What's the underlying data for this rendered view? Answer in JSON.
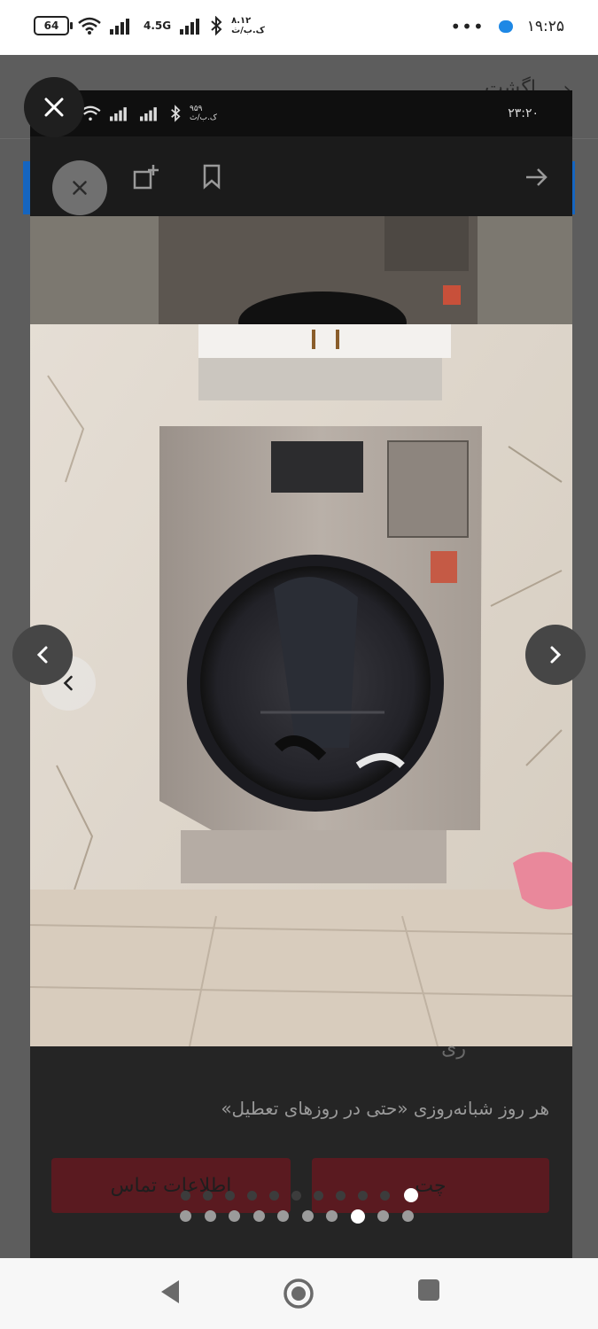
{
  "status_bar": {
    "battery": "64",
    "network": "4.5G",
    "speed": "۸.۱۲",
    "speed_unit": "ک.ب/ث",
    "more": "•••",
    "time": "۱۹:۲۵"
  },
  "background_page": {
    "title": "…اگشت"
  },
  "inner_screenshot": {
    "status_time": "۲۳:۲۰",
    "status_speed": "۹۵۹",
    "status_speed_unit": "ک.ب/ث",
    "hours_text": "هر روز شبانه‌روزی «حتی در روزهای تعطیل»",
    "contact_label": "اطلاعات تماس",
    "chat_label": "چت",
    "partial_text": "ری"
  },
  "pager": {
    "total": 10,
    "active_index": 7
  },
  "colors": {
    "accent_blue": "#1565c0",
    "inner_button": "#5a1a20",
    "overlay": "#5d5d5d"
  },
  "icons": {
    "close": "close-icon",
    "prev": "chevron-left-icon",
    "next": "chevron-right-icon",
    "bookmark": "bookmark-icon",
    "add_note": "add-note-icon",
    "forward": "arrow-right-icon",
    "nav_back": "triangle-back-icon",
    "nav_home": "circle-home-icon",
    "nav_recent": "square-recent-icon"
  }
}
